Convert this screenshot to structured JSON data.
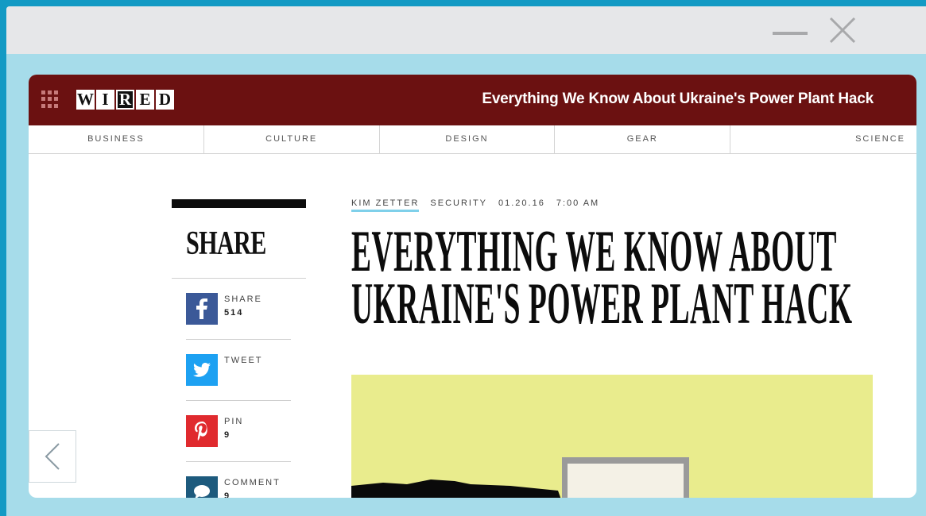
{
  "window": {
    "controls": [
      "minimize",
      "close"
    ]
  },
  "site": {
    "logo_letters": [
      "W",
      "I",
      "R",
      "E",
      "D"
    ],
    "header_title": "Everything We Know About Ukraine's Power Plant Hack",
    "brand_color": "#6b1111"
  },
  "nav": {
    "items": [
      "BUSINESS",
      "CULTURE",
      "DESIGN",
      "GEAR",
      "SCIENCE"
    ]
  },
  "share": {
    "heading": "SHARE",
    "items": [
      {
        "icon": "facebook-icon",
        "label": "SHARE",
        "count": "514",
        "color": "#3b5998"
      },
      {
        "icon": "twitter-icon",
        "label": "TWEET",
        "count": "",
        "color": "#1da1f2"
      },
      {
        "icon": "pinterest-icon",
        "label": "PIN",
        "count": "9",
        "color": "#e02a2e"
      },
      {
        "icon": "comment-icon",
        "label": "COMMENT",
        "count": "9",
        "color": "#1d5a7d"
      }
    ]
  },
  "article": {
    "author": "KIM ZETTER",
    "category": "SECURITY",
    "date": "01.20.16",
    "time": "7:00 AM",
    "headline_lines": [
      "EVERYTHING WE KNOW ABOUT",
      "UKRAINE'S POWER PLANT HACK"
    ],
    "hero_bg": "#e9ec8d"
  }
}
